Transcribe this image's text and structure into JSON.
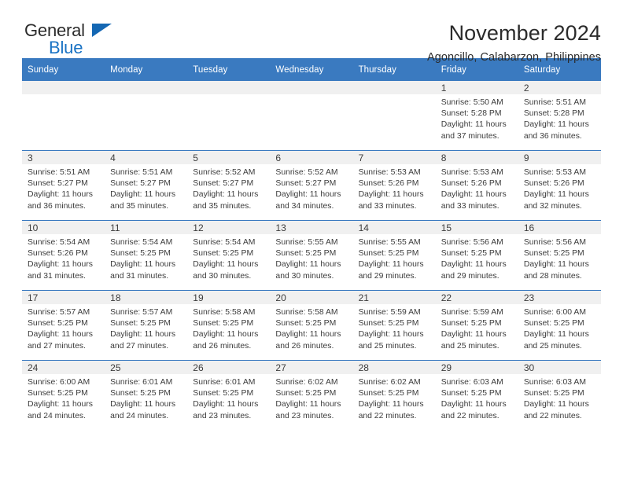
{
  "brand": {
    "name_part1": "General",
    "name_part2": "Blue",
    "accent_color": "#1a73c4",
    "triangle_icon": "triangle-icon"
  },
  "header": {
    "title": "November 2024",
    "subtitle": "Agoncillo, Calabarzon, Philippines"
  },
  "calendar": {
    "header_bg": "#3a7ac0",
    "daynum_bg": "#f0f0f0",
    "weekdays": [
      "Sunday",
      "Monday",
      "Tuesday",
      "Wednesday",
      "Thursday",
      "Friday",
      "Saturday"
    ],
    "weeks": [
      [
        {
          "day": "",
          "sunrise": "",
          "sunset": "",
          "daylight1": "",
          "daylight2": ""
        },
        {
          "day": "",
          "sunrise": "",
          "sunset": "",
          "daylight1": "",
          "daylight2": ""
        },
        {
          "day": "",
          "sunrise": "",
          "sunset": "",
          "daylight1": "",
          "daylight2": ""
        },
        {
          "day": "",
          "sunrise": "",
          "sunset": "",
          "daylight1": "",
          "daylight2": ""
        },
        {
          "day": "",
          "sunrise": "",
          "sunset": "",
          "daylight1": "",
          "daylight2": ""
        },
        {
          "day": "1",
          "sunrise": "Sunrise: 5:50 AM",
          "sunset": "Sunset: 5:28 PM",
          "daylight1": "Daylight: 11 hours",
          "daylight2": "and 37 minutes."
        },
        {
          "day": "2",
          "sunrise": "Sunrise: 5:51 AM",
          "sunset": "Sunset: 5:28 PM",
          "daylight1": "Daylight: 11 hours",
          "daylight2": "and 36 minutes."
        }
      ],
      [
        {
          "day": "3",
          "sunrise": "Sunrise: 5:51 AM",
          "sunset": "Sunset: 5:27 PM",
          "daylight1": "Daylight: 11 hours",
          "daylight2": "and 36 minutes."
        },
        {
          "day": "4",
          "sunrise": "Sunrise: 5:51 AM",
          "sunset": "Sunset: 5:27 PM",
          "daylight1": "Daylight: 11 hours",
          "daylight2": "and 35 minutes."
        },
        {
          "day": "5",
          "sunrise": "Sunrise: 5:52 AM",
          "sunset": "Sunset: 5:27 PM",
          "daylight1": "Daylight: 11 hours",
          "daylight2": "and 35 minutes."
        },
        {
          "day": "6",
          "sunrise": "Sunrise: 5:52 AM",
          "sunset": "Sunset: 5:27 PM",
          "daylight1": "Daylight: 11 hours",
          "daylight2": "and 34 minutes."
        },
        {
          "day": "7",
          "sunrise": "Sunrise: 5:53 AM",
          "sunset": "Sunset: 5:26 PM",
          "daylight1": "Daylight: 11 hours",
          "daylight2": "and 33 minutes."
        },
        {
          "day": "8",
          "sunrise": "Sunrise: 5:53 AM",
          "sunset": "Sunset: 5:26 PM",
          "daylight1": "Daylight: 11 hours",
          "daylight2": "and 33 minutes."
        },
        {
          "day": "9",
          "sunrise": "Sunrise: 5:53 AM",
          "sunset": "Sunset: 5:26 PM",
          "daylight1": "Daylight: 11 hours",
          "daylight2": "and 32 minutes."
        }
      ],
      [
        {
          "day": "10",
          "sunrise": "Sunrise: 5:54 AM",
          "sunset": "Sunset: 5:26 PM",
          "daylight1": "Daylight: 11 hours",
          "daylight2": "and 31 minutes."
        },
        {
          "day": "11",
          "sunrise": "Sunrise: 5:54 AM",
          "sunset": "Sunset: 5:25 PM",
          "daylight1": "Daylight: 11 hours",
          "daylight2": "and 31 minutes."
        },
        {
          "day": "12",
          "sunrise": "Sunrise: 5:54 AM",
          "sunset": "Sunset: 5:25 PM",
          "daylight1": "Daylight: 11 hours",
          "daylight2": "and 30 minutes."
        },
        {
          "day": "13",
          "sunrise": "Sunrise: 5:55 AM",
          "sunset": "Sunset: 5:25 PM",
          "daylight1": "Daylight: 11 hours",
          "daylight2": "and 30 minutes."
        },
        {
          "day": "14",
          "sunrise": "Sunrise: 5:55 AM",
          "sunset": "Sunset: 5:25 PM",
          "daylight1": "Daylight: 11 hours",
          "daylight2": "and 29 minutes."
        },
        {
          "day": "15",
          "sunrise": "Sunrise: 5:56 AM",
          "sunset": "Sunset: 5:25 PM",
          "daylight1": "Daylight: 11 hours",
          "daylight2": "and 29 minutes."
        },
        {
          "day": "16",
          "sunrise": "Sunrise: 5:56 AM",
          "sunset": "Sunset: 5:25 PM",
          "daylight1": "Daylight: 11 hours",
          "daylight2": "and 28 minutes."
        }
      ],
      [
        {
          "day": "17",
          "sunrise": "Sunrise: 5:57 AM",
          "sunset": "Sunset: 5:25 PM",
          "daylight1": "Daylight: 11 hours",
          "daylight2": "and 27 minutes."
        },
        {
          "day": "18",
          "sunrise": "Sunrise: 5:57 AM",
          "sunset": "Sunset: 5:25 PM",
          "daylight1": "Daylight: 11 hours",
          "daylight2": "and 27 minutes."
        },
        {
          "day": "19",
          "sunrise": "Sunrise: 5:58 AM",
          "sunset": "Sunset: 5:25 PM",
          "daylight1": "Daylight: 11 hours",
          "daylight2": "and 26 minutes."
        },
        {
          "day": "20",
          "sunrise": "Sunrise: 5:58 AM",
          "sunset": "Sunset: 5:25 PM",
          "daylight1": "Daylight: 11 hours",
          "daylight2": "and 26 minutes."
        },
        {
          "day": "21",
          "sunrise": "Sunrise: 5:59 AM",
          "sunset": "Sunset: 5:25 PM",
          "daylight1": "Daylight: 11 hours",
          "daylight2": "and 25 minutes."
        },
        {
          "day": "22",
          "sunrise": "Sunrise: 5:59 AM",
          "sunset": "Sunset: 5:25 PM",
          "daylight1": "Daylight: 11 hours",
          "daylight2": "and 25 minutes."
        },
        {
          "day": "23",
          "sunrise": "Sunrise: 6:00 AM",
          "sunset": "Sunset: 5:25 PM",
          "daylight1": "Daylight: 11 hours",
          "daylight2": "and 25 minutes."
        }
      ],
      [
        {
          "day": "24",
          "sunrise": "Sunrise: 6:00 AM",
          "sunset": "Sunset: 5:25 PM",
          "daylight1": "Daylight: 11 hours",
          "daylight2": "and 24 minutes."
        },
        {
          "day": "25",
          "sunrise": "Sunrise: 6:01 AM",
          "sunset": "Sunset: 5:25 PM",
          "daylight1": "Daylight: 11 hours",
          "daylight2": "and 24 minutes."
        },
        {
          "day": "26",
          "sunrise": "Sunrise: 6:01 AM",
          "sunset": "Sunset: 5:25 PM",
          "daylight1": "Daylight: 11 hours",
          "daylight2": "and 23 minutes."
        },
        {
          "day": "27",
          "sunrise": "Sunrise: 6:02 AM",
          "sunset": "Sunset: 5:25 PM",
          "daylight1": "Daylight: 11 hours",
          "daylight2": "and 23 minutes."
        },
        {
          "day": "28",
          "sunrise": "Sunrise: 6:02 AM",
          "sunset": "Sunset: 5:25 PM",
          "daylight1": "Daylight: 11 hours",
          "daylight2": "and 22 minutes."
        },
        {
          "day": "29",
          "sunrise": "Sunrise: 6:03 AM",
          "sunset": "Sunset: 5:25 PM",
          "daylight1": "Daylight: 11 hours",
          "daylight2": "and 22 minutes."
        },
        {
          "day": "30",
          "sunrise": "Sunrise: 6:03 AM",
          "sunset": "Sunset: 5:25 PM",
          "daylight1": "Daylight: 11 hours",
          "daylight2": "and 22 minutes."
        }
      ]
    ]
  }
}
